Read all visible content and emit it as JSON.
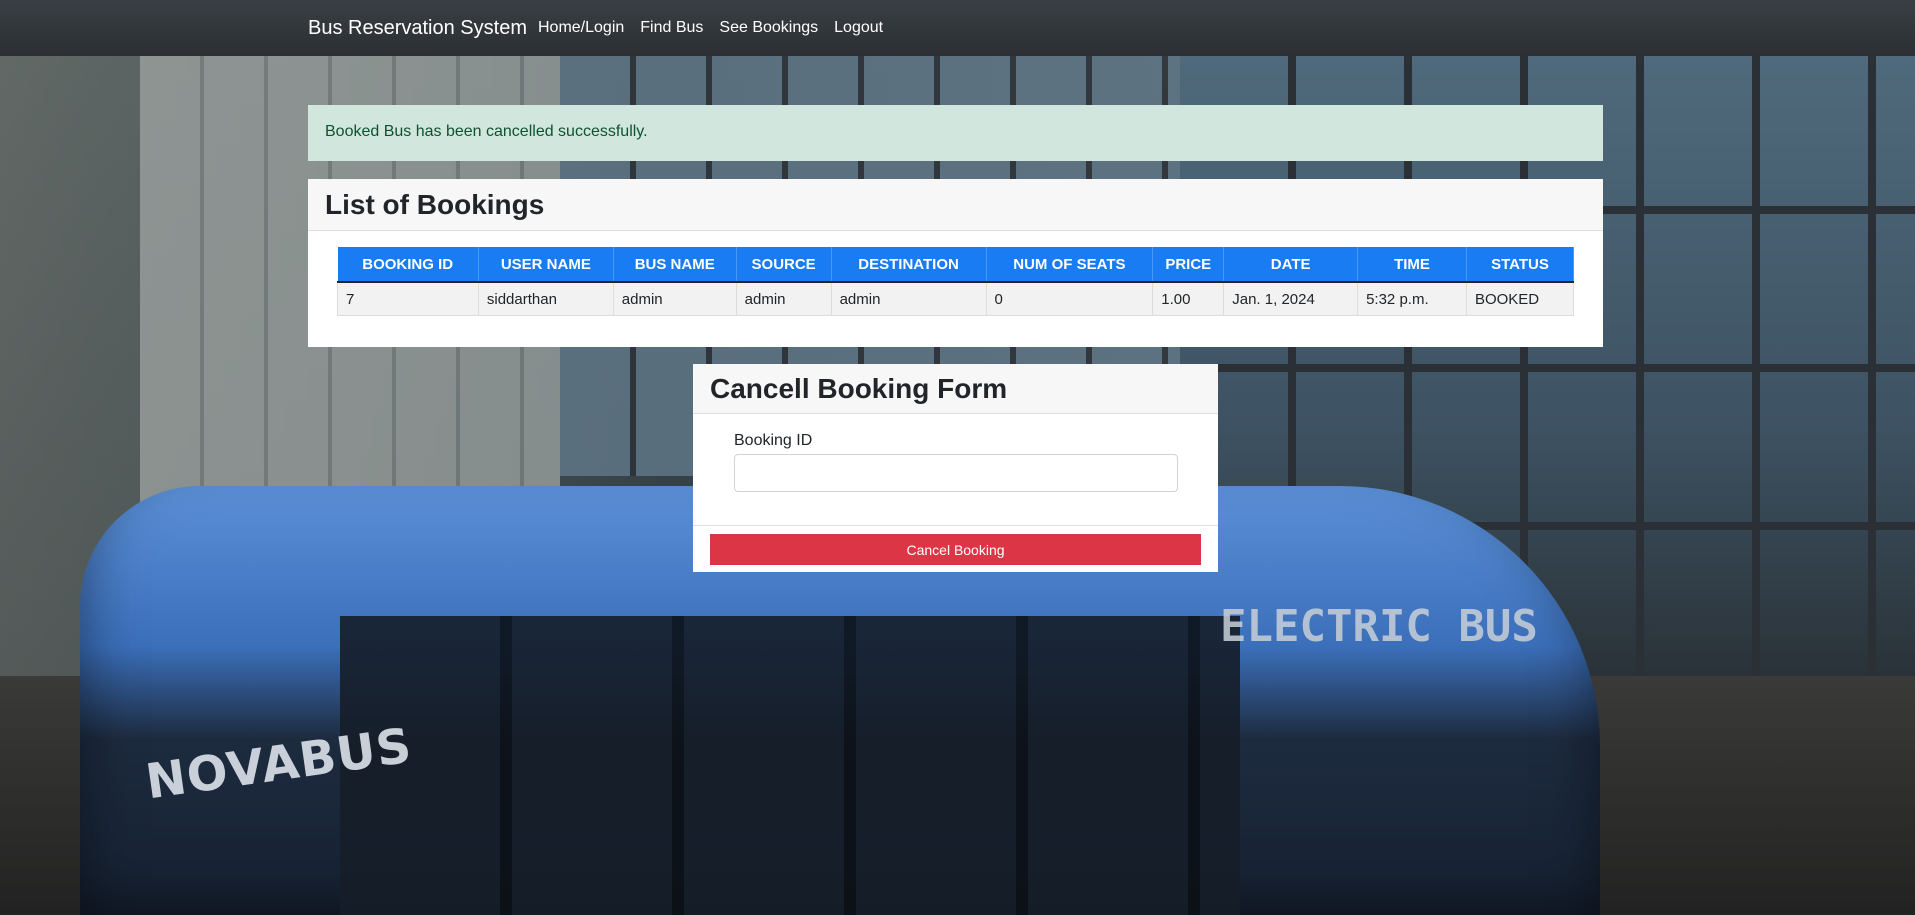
{
  "navbar": {
    "brand": "Bus Reservation System",
    "links": [
      "Home/Login",
      "Find Bus",
      "See Bookings",
      "Logout"
    ]
  },
  "alert": {
    "message": "Booked Bus has been cancelled successfully."
  },
  "bookings": {
    "title": "List of Bookings",
    "columns": [
      "BOOKING ID",
      "USER NAME",
      "BUS NAME",
      "SOURCE",
      "DESTINATION",
      "NUM OF SEATS",
      "PRICE",
      "DATE",
      "TIME",
      "STATUS"
    ],
    "rows": [
      [
        "7",
        "siddarthan",
        "admin",
        "admin",
        "admin",
        "0",
        "1.00",
        "Jan. 1, 2024",
        "5:32 p.m.",
        "BOOKED"
      ]
    ]
  },
  "cancel_form": {
    "title": "Cancell Booking Form",
    "field_label": "Booking ID",
    "field_value": "",
    "submit_label": "Cancel Booking"
  },
  "background": {
    "bus_brand_text": "NOVABUS",
    "bus_sign_text": "ELECTRIC BUS"
  },
  "colors": {
    "navbar": "#2b2f33",
    "alert_bg": "#d1e7dd",
    "alert_text": "#0f5132",
    "table_header": "#1a7cf2",
    "danger_button": "#dc3545"
  }
}
